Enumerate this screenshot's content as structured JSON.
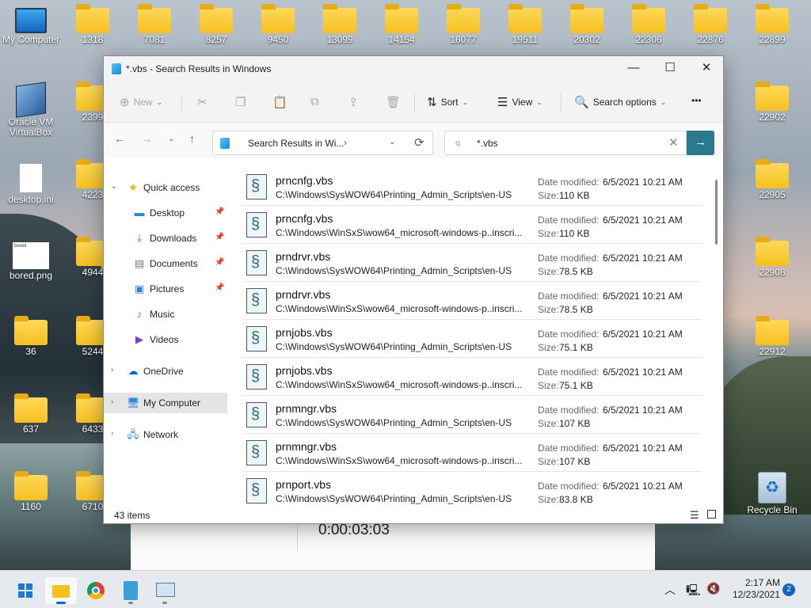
{
  "desktop": {
    "icons": [
      {
        "label": "My Computer",
        "kind": "computer-icon"
      },
      {
        "label": "Oracle VM VirtualBox",
        "kind": "virtualbox-icon"
      },
      {
        "label": "desktop.ini",
        "kind": "file-icon"
      },
      {
        "label": "bored.png",
        "kind": "image-icon",
        "thumb_text": "bored"
      },
      {
        "label": "36",
        "kind": "folder-icon"
      },
      {
        "label": "637",
        "kind": "folder-icon"
      },
      {
        "label": "1160",
        "kind": "folder-icon"
      },
      {
        "label": "1318",
        "kind": "folder-icon"
      },
      {
        "label": "2399",
        "kind": "folder-icon"
      },
      {
        "label": "4223",
        "kind": "folder-icon"
      },
      {
        "label": "4944",
        "kind": "folder-icon"
      },
      {
        "label": "5244",
        "kind": "folder-icon"
      },
      {
        "label": "6433",
        "kind": "folder-icon"
      },
      {
        "label": "6710",
        "kind": "folder-icon"
      },
      {
        "label": "7081",
        "kind": "folder-icon"
      },
      {
        "label": "8257",
        "kind": "folder-icon"
      },
      {
        "label": "9450",
        "kind": "folder-icon"
      },
      {
        "label": "13099",
        "kind": "folder-icon"
      },
      {
        "label": "14154",
        "kind": "folder-icon"
      },
      {
        "label": "16077",
        "kind": "folder-icon"
      },
      {
        "label": "19511",
        "kind": "folder-icon"
      },
      {
        "label": "20302",
        "kind": "folder-icon"
      },
      {
        "label": "22306",
        "kind": "folder-icon"
      },
      {
        "label": "22876",
        "kind": "folder-icon"
      },
      {
        "label": "22899",
        "kind": "folder-icon"
      },
      {
        "label": "22902",
        "kind": "folder-icon"
      },
      {
        "label": "22905",
        "kind": "folder-icon"
      },
      {
        "label": "22908",
        "kind": "folder-icon"
      },
      {
        "label": "22912",
        "kind": "folder-icon"
      },
      {
        "label": "Recycle Bin",
        "kind": "recycle-bin-icon"
      }
    ]
  },
  "background_app": {
    "timer": "0:00:03:03"
  },
  "window": {
    "title": "*.vbs - Search Results in Windows",
    "controls": {
      "minimize": "—",
      "maximize": "☐",
      "close": "✕"
    },
    "toolbar": {
      "new_label": "New",
      "sort_label": "Sort",
      "view_label": "View",
      "search_options_label": "Search options",
      "more_label": "•••"
    },
    "address": {
      "path": "Search Results in Wi...",
      "separator": "›"
    },
    "search": {
      "value": "*.vbs"
    },
    "sidebar": {
      "quick_access": "Quick access",
      "items": [
        "Desktop",
        "Downloads",
        "Documents",
        "Pictures",
        "Music",
        "Videos"
      ],
      "onedrive": "OneDrive",
      "my_computer": "My Computer",
      "network": "Network"
    },
    "files": [
      {
        "name": "prncnfg.vbs",
        "path": "C:\\Windows\\SysWOW64\\Printing_Admin_Scripts\\en-US",
        "date_label": "Date modified:",
        "date": "6/5/2021 10:21 AM",
        "size_label": "Size:",
        "size": "110 KB"
      },
      {
        "name": "prncnfg.vbs",
        "path": "C:\\Windows\\WinSxS\\wow64_microsoft-windows-p..inscri...",
        "date_label": "Date modified:",
        "date": "6/5/2021 10:21 AM",
        "size_label": "Size:",
        "size": "110 KB"
      },
      {
        "name": "prndrvr.vbs",
        "path": "C:\\Windows\\SysWOW64\\Printing_Admin_Scripts\\en-US",
        "date_label": "Date modified:",
        "date": "6/5/2021 10:21 AM",
        "size_label": "Size:",
        "size": "78.5 KB"
      },
      {
        "name": "prndrvr.vbs",
        "path": "C:\\Windows\\WinSxS\\wow64_microsoft-windows-p..inscri...",
        "date_label": "Date modified:",
        "date": "6/5/2021 10:21 AM",
        "size_label": "Size:",
        "size": "78.5 KB"
      },
      {
        "name": "prnjobs.vbs",
        "path": "C:\\Windows\\SysWOW64\\Printing_Admin_Scripts\\en-US",
        "date_label": "Date modified:",
        "date": "6/5/2021 10:21 AM",
        "size_label": "Size:",
        "size": "75.1 KB"
      },
      {
        "name": "prnjobs.vbs",
        "path": "C:\\Windows\\WinSxS\\wow64_microsoft-windows-p..inscri...",
        "date_label": "Date modified:",
        "date": "6/5/2021 10:21 AM",
        "size_label": "Size:",
        "size": "75.1 KB"
      },
      {
        "name": "prnmngr.vbs",
        "path": "C:\\Windows\\SysWOW64\\Printing_Admin_Scripts\\en-US",
        "date_label": "Date modified:",
        "date": "6/5/2021 10:21 AM",
        "size_label": "Size:",
        "size": "107 KB"
      },
      {
        "name": "prnmngr.vbs",
        "path": "C:\\Windows\\WinSxS\\wow64_microsoft-windows-p..inscri...",
        "date_label": "Date modified:",
        "date": "6/5/2021 10:21 AM",
        "size_label": "Size:",
        "size": "107 KB"
      },
      {
        "name": "prnport.vbs",
        "path": "C:\\Windows\\SysWOW64\\Printing_Admin_Scripts\\en-US",
        "date_label": "Date modified:",
        "date": "6/5/2021 10:21 AM",
        "size_label": "Size:",
        "size": "83.8 KB"
      }
    ],
    "status": {
      "count": "43 items"
    }
  },
  "taskbar": {
    "apps": [
      "start-icon",
      "file-explorer-icon",
      "chrome-icon",
      "notepad-icon",
      "monitor-app-icon"
    ],
    "clock_time": "2:17 AM",
    "clock_date": "12/23/2021",
    "notification_count": "2"
  }
}
